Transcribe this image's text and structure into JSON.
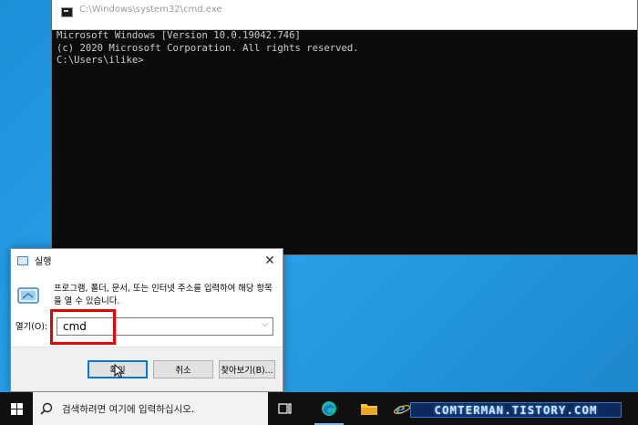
{
  "cmd": {
    "title": "C:\\Windows\\system32\\cmd.exe",
    "lines": [
      "Microsoft Windows [Version 10.0.19042.746]",
      "(c) 2020 Microsoft Corporation. All rights reserved.",
      "",
      "C:\\Users\\ilike>"
    ]
  },
  "run": {
    "title": "실행",
    "description": "프로그램, 폴더, 문서, 또는 인터넷 주소를 입력하여 해당 항목을 열 수 있습니다.",
    "open_label": "열기(O):",
    "input_value": "cmd",
    "ok_label": "확인",
    "cancel_label": "취소",
    "browse_label": "찾아보기(B)...",
    "close_icon": "close-icon"
  },
  "taskbar": {
    "search_placeholder": "검색하려면 여기에 입력하십시오.",
    "icons": [
      "windows-logo-icon",
      "search-icon",
      "task-view-icon",
      "edge-icon",
      "file-explorer-icon",
      "internet-explorer-icon"
    ]
  },
  "watermark": {
    "text": "COMTERMAN.TISTORY.COM"
  },
  "colors": {
    "desktop": "#1d8fd8",
    "taskbar": "#101010",
    "cmd_background": "#0c0c0c",
    "highlight": "#e60000",
    "ok_border": "#0078d7"
  }
}
